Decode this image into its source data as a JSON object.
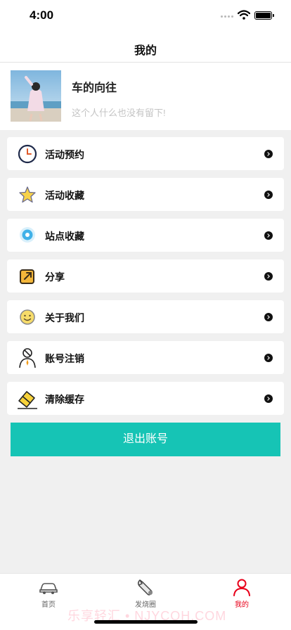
{
  "status_bar": {
    "time": "4:00"
  },
  "nav": {
    "title": "我的"
  },
  "profile": {
    "name": "车的向往",
    "signature": "这个人什么也没有留下!"
  },
  "menu": [
    {
      "label": "活动预约",
      "icon": "clock-icon"
    },
    {
      "label": "活动收藏",
      "icon": "star-icon"
    },
    {
      "label": "站点收藏",
      "icon": "location-pin-icon"
    },
    {
      "label": "分享",
      "icon": "share-icon"
    },
    {
      "label": "关于我们",
      "icon": "smiley-icon"
    },
    {
      "label": "账号注销",
      "icon": "user-cancel-icon"
    },
    {
      "label": "清除缓存",
      "icon": "eraser-icon"
    }
  ],
  "logout_label": "退出账号",
  "tabs": [
    {
      "label": "首页",
      "icon": "car-icon"
    },
    {
      "label": "发烧圈",
      "icon": "wrench-icon"
    },
    {
      "label": "我的",
      "icon": "user-icon",
      "active": true
    }
  ],
  "watermark": "乐享轻汇 • NJYCQH.COM",
  "colors": {
    "accent": "#16c4b5",
    "active_tab": "#e8001a"
  }
}
